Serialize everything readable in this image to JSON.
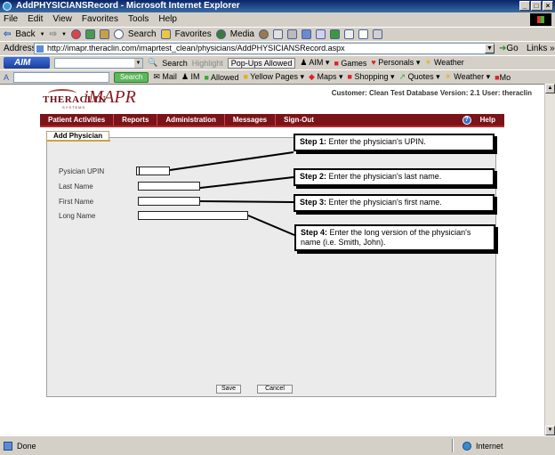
{
  "window": {
    "title": "AddPHYSICIANSRecord - Microsoft Internet Explorer",
    "controls": [
      "_",
      "□",
      "×"
    ]
  },
  "menu": [
    "File",
    "Edit",
    "View",
    "Favorites",
    "Tools",
    "Help"
  ],
  "toolbar": {
    "back": "Back",
    "search": "Search",
    "favorites": "Favorites",
    "media": "Media"
  },
  "address": {
    "label": "Address",
    "url": "http://imapr.theraclin.com/imaprtest_clean/physicians/AddPHYSICIANSRecord.aspx",
    "go": "Go",
    "links": "Links"
  },
  "aim_bar": {
    "logo": "AIM",
    "search": "Search",
    "highlight": "Highlight",
    "popups": "Pop-Ups Allowed",
    "aim": "AIM",
    "games": "Games",
    "personals": "Personals",
    "weather": "Weather"
  },
  "search_bar": {
    "button": "Search",
    "mail": "Mail",
    "im": "IM",
    "allowed": "Allowed",
    "yellow_pages": "Yellow Pages",
    "maps": "Maps",
    "shopping": "Shopping",
    "quotes": "Quotes",
    "weather": "Weather",
    "more": "Mo"
  },
  "app": {
    "brand_left": "THERACLIN",
    "brand_left_sub": "SYSTEMS",
    "brand_right": "iMAPR",
    "customer_info": "Customer: Clean Test Database Version: 2.1 User: theraclin",
    "nav": [
      "Patient Activities",
      "Reports",
      "Administration",
      "Messages",
      "Sign-Out"
    ],
    "help": "Help"
  },
  "form": {
    "tab": "Add Physician",
    "fields": {
      "upin_label": "Pysician UPIN",
      "last_label": "Last Name",
      "first_label": "First Name",
      "long_label": "Long Name"
    },
    "save": "Save",
    "cancel": "Cancel"
  },
  "callouts": {
    "step1_title": "Step 1:",
    "step1_text": " Enter the physician's UPIN.",
    "step2_title": "Step 2:",
    "step2_text": " Enter the physician's last name.",
    "step3_title": "Step 3:",
    "step3_text": " Enter the physician's first name.",
    "step4_title": "Step 4:",
    "step4_text": " Enter the long version of the physician's name (i.e. Smith, John)."
  },
  "status": {
    "left": "Done",
    "right": "Internet"
  }
}
